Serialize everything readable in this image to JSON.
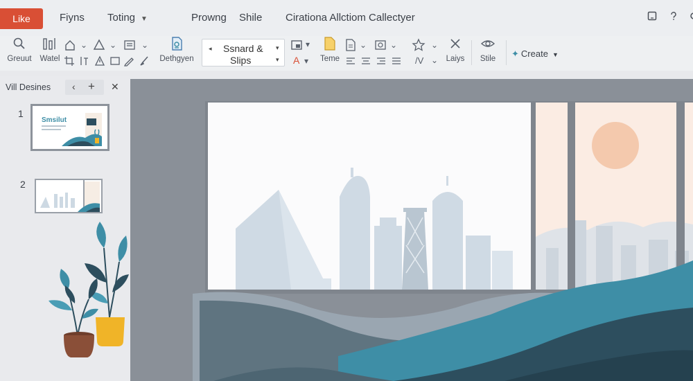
{
  "topbar": {
    "like_label": "Like",
    "menus": [
      {
        "label": "Fiyns"
      },
      {
        "label": "Toting"
      },
      {
        "label": "Prowng"
      },
      {
        "label": "Shile"
      }
    ],
    "doc_title": "Cirationa Allctiom Callectyer",
    "icons": [
      "window-icon",
      "help-icon",
      "settings-icon"
    ]
  },
  "ribbon": {
    "tools": [
      {
        "name": "find",
        "label": "Greuut"
      },
      {
        "name": "watermark",
        "label": "Watel"
      },
      {
        "name": "designer",
        "label": "Dethgyen"
      },
      {
        "name": "theme",
        "label": "Teme"
      },
      {
        "name": "layout",
        "label": "Laiys"
      },
      {
        "name": "style",
        "label": "Stile"
      }
    ],
    "font": {
      "line1": "Ssnard &",
      "line2": "Slips"
    },
    "font_color_glyph": "A",
    "spacing_glyph": "/V",
    "create_label": "Create"
  },
  "pane": {
    "title": "Vill Desines",
    "slides": [
      {
        "number": "1",
        "thumb_title": "Smsilut"
      },
      {
        "number": "2"
      }
    ]
  },
  "colors": {
    "accent_red": "#d94f35",
    "teal": "#3e8ea6",
    "dark_teal": "#2d4e5e",
    "pot_brown": "#8a4f38",
    "pot_yellow": "#f0b428",
    "canvas_gray": "#8a9098",
    "sun_peach": "#f4c9ad"
  }
}
